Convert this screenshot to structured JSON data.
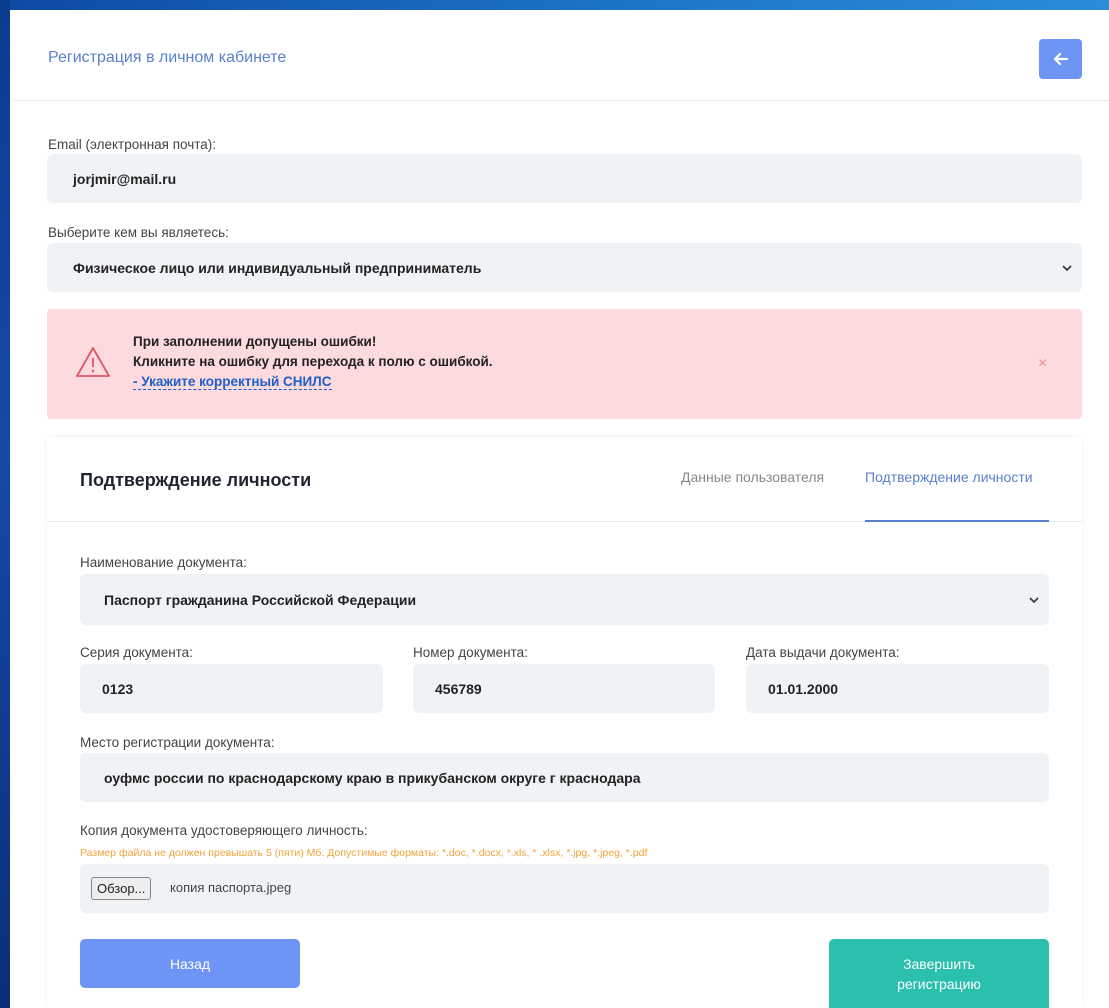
{
  "header": {
    "title": "Регистрация в личном кабинете"
  },
  "email": {
    "label": "Email (электронная почта):",
    "value": "jorjmir@mail.ru"
  },
  "role": {
    "label": "Выберите кем вы являетесь:",
    "value": "Физическое лицо или индивидуальный предприниматель"
  },
  "alert": {
    "title": "При заполнении допущены ошибки!",
    "subtitle": "Кликните на ошибку для перехода к полю с ошибкой.",
    "error_link": "- Укажите корректный СНИЛС",
    "close": "×"
  },
  "section": {
    "title": "Подтверждение личности",
    "tabs": [
      {
        "label": "Данные пользователя"
      },
      {
        "label": "Подтверждение личности"
      }
    ]
  },
  "doc_name": {
    "label": "Наименование документа:",
    "value": "Паспорт гражданина Российской Федерации"
  },
  "doc_series": {
    "label": "Серия документа:",
    "value": "0123"
  },
  "doc_number": {
    "label": "Номер документа:",
    "value": "456789"
  },
  "doc_date": {
    "label": "Дата выдачи документа:",
    "value": "01.01.2000"
  },
  "doc_place": {
    "label": "Место регистрации документа:",
    "value": "оуфмс россии по краснодарскому краю в прикубанском округе г краснодара"
  },
  "doc_copy": {
    "label": "Копия документа удостоверяющего личность:",
    "hint": "Размер файла не должен превышать 5 (пяти) Мб. Допустимые форматы: *.doc, *.docx, *.xls, * .xlsx, *.jpg, *.jpeg, *.pdf",
    "browse_label": "Обзор...",
    "file_name": "копия паспорта.jpeg"
  },
  "buttons": {
    "back": "Назад",
    "finish_line1": "Завершить",
    "finish_line2": "регистрацию"
  },
  "colors": {
    "accent": "#5b7fcf",
    "primary_button": "#6e95f5",
    "finish_button": "#2bbfae",
    "alert_bg": "#fcdadd",
    "hint": "#f2a33a"
  }
}
